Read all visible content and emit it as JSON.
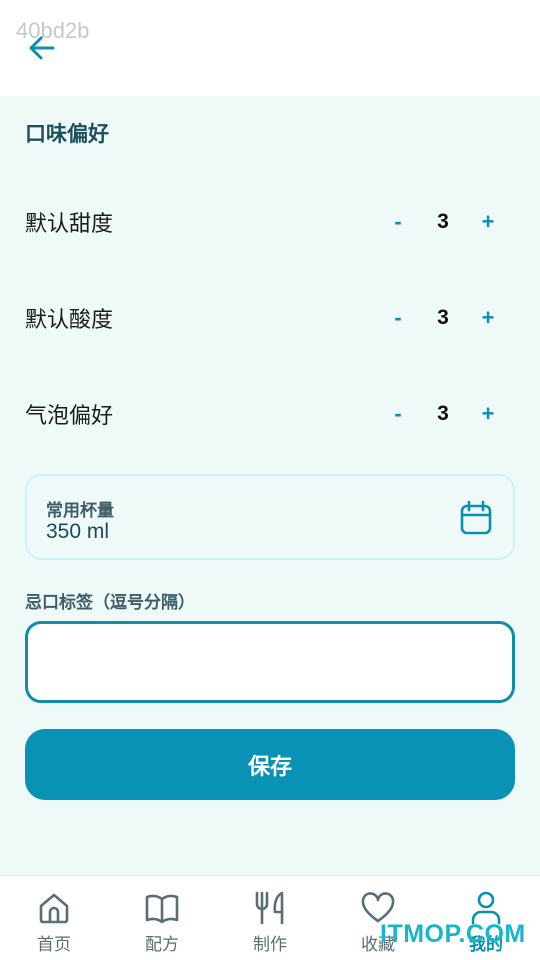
{
  "header": {
    "code": "40bd2b",
    "back_icon": "arrow-left-icon"
  },
  "colors": {
    "accent": "#0a92b4",
    "background": "#effaf8",
    "title": "#1d4f5e"
  },
  "section": {
    "title": "口味偏好"
  },
  "preferences": [
    {
      "label": "默认甜度",
      "minus": "-",
      "value": "3",
      "plus": "+"
    },
    {
      "label": "默认酸度",
      "minus": "-",
      "value": "3",
      "plus": "+"
    },
    {
      "label": "气泡偏好",
      "minus": "-",
      "value": "3",
      "plus": "+"
    }
  ],
  "cup": {
    "label": "常用杯量",
    "value": "350 ml",
    "icon": "calendar-icon"
  },
  "tags": {
    "label": "忌口标签（逗号分隔）",
    "value": "",
    "placeholder": ""
  },
  "save": {
    "label": "保存"
  },
  "tabbar": {
    "items": [
      {
        "label": "首页",
        "icon": "home-icon"
      },
      {
        "label": "配方",
        "icon": "book-icon"
      },
      {
        "label": "制作",
        "icon": "fork-knife-icon"
      },
      {
        "label": "收藏",
        "icon": "heart-icon"
      },
      {
        "label": "我的",
        "icon": "user-icon",
        "active": true
      }
    ]
  },
  "watermark": "ITMOP.COM"
}
